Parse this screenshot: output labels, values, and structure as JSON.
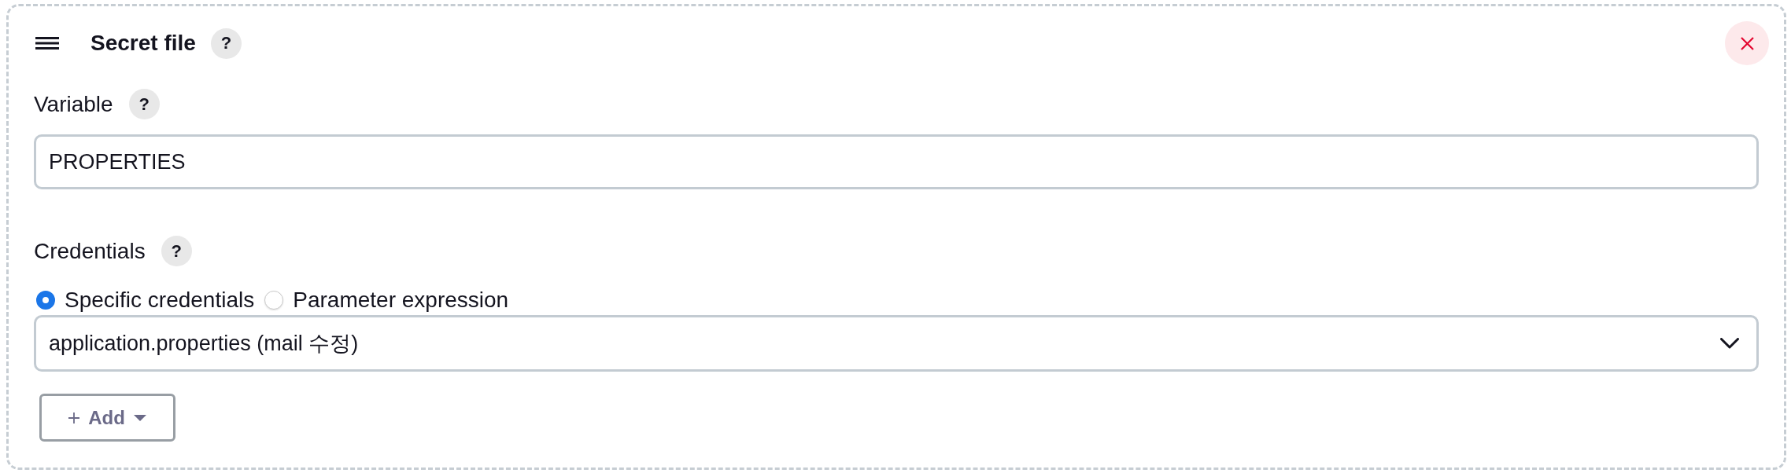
{
  "header": {
    "title": "Secret file",
    "help": "?"
  },
  "fields": [
    {
      "kind": "text",
      "label": "Variable",
      "help": "?",
      "value": "PROPERTIES"
    },
    {
      "kind": "credentials",
      "label": "Credentials",
      "help": "?",
      "options": [
        {
          "label": "Specific credentials",
          "selected": true
        },
        {
          "label": "Parameter expression",
          "selected": false
        }
      ],
      "value": "application.properties (mail 수정)",
      "add_button": "Add"
    }
  ]
}
